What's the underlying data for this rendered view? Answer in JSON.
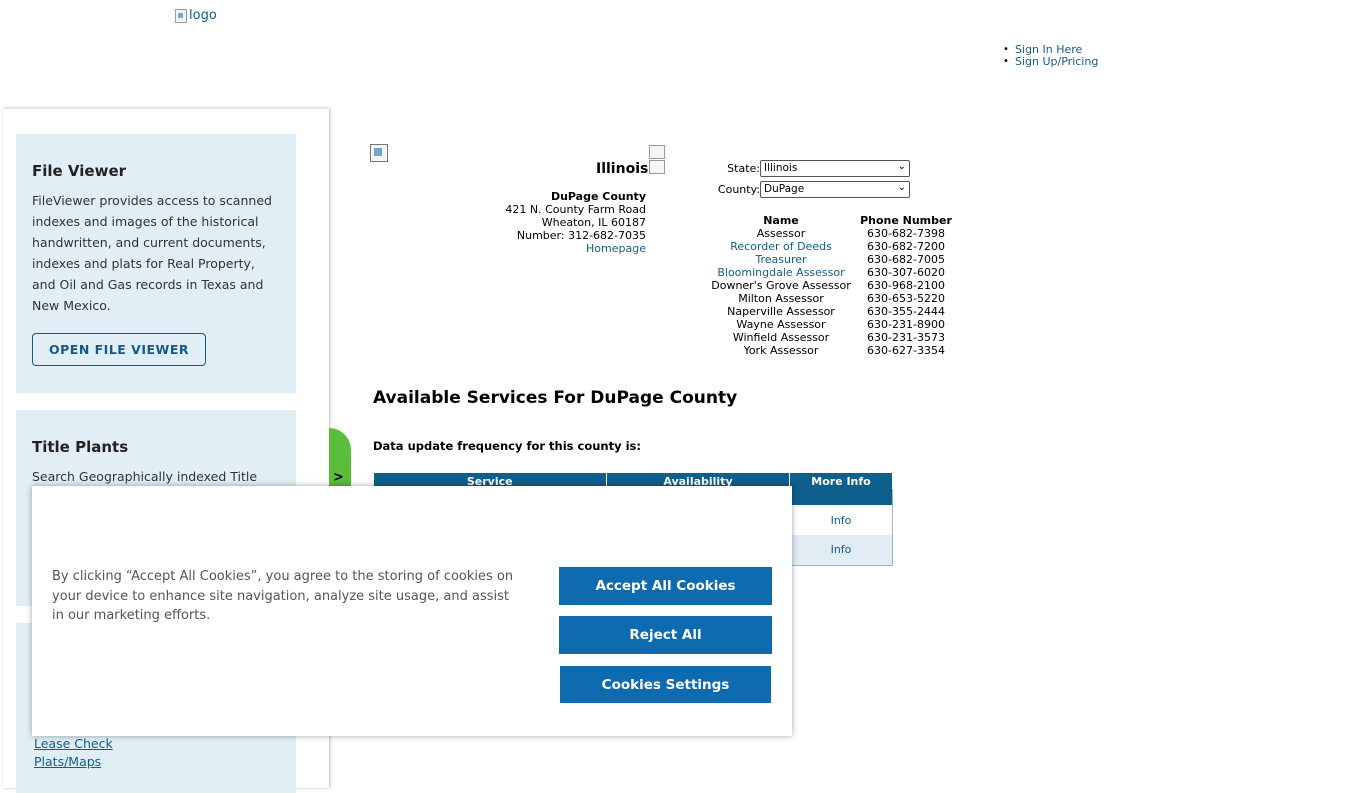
{
  "header": {
    "logo_alt": "logo",
    "user_links": [
      "Sign In Here",
      "Sign Up/Pricing"
    ]
  },
  "sidebar": {
    "file_viewer": {
      "title": "File Viewer",
      "description": "FileViewer provides access to scanned indexes and images of the historical handwritten, and current documents, indexes and plats for Real Property, and Oil and Gas records in Texas and New Mexico.",
      "button": "OPEN FILE VIEWER"
    },
    "title_plants": {
      "title": "Title Plants",
      "description": "Search Geographically indexed Title"
    },
    "bottom_links": [
      "Lease Check",
      "Plats/Maps"
    ],
    "tab_arrow": ">"
  },
  "county": {
    "state_name": "Illinois",
    "county_name": "DuPage County",
    "address_line1": "421 N. County Farm Road",
    "address_line2": "Wheaton, IL 60187",
    "phone_line": "Number: 312-682-7035",
    "homepage_link": "Homepage"
  },
  "selectors": {
    "state_label": "State:",
    "state_value": "Illinois",
    "county_label": "County:",
    "county_value": "DuPage"
  },
  "contacts": {
    "headers": [
      "Name",
      "Phone Number"
    ],
    "rows": [
      {
        "name": "Assessor",
        "phone": "630-682-7398",
        "link": false
      },
      {
        "name": "Recorder of Deeds",
        "phone": "630-682-7200",
        "link": true
      },
      {
        "name": "Treasurer",
        "phone": "630-682-7005",
        "link": true
      },
      {
        "name": "Bloomingdale Assessor",
        "phone": "630-307-6020",
        "link": true
      },
      {
        "name": "Downer's Grove Assessor",
        "phone": "630-968-2100",
        "link": false
      },
      {
        "name": "Milton Assessor",
        "phone": "630-653-5220",
        "link": false
      },
      {
        "name": "Naperville Assessor",
        "phone": "630-355-2444",
        "link": false
      },
      {
        "name": "Wayne Assessor",
        "phone": "630-231-8900",
        "link": false
      },
      {
        "name": "Winfield Assessor",
        "phone": "630-231-3573",
        "link": false
      },
      {
        "name": "York Assessor",
        "phone": "630-627-3354",
        "link": false
      }
    ]
  },
  "services": {
    "title": "Available Services For DuPage County",
    "frequency_text": "Data update frequency for this county is:",
    "headers": [
      "Service",
      "Availability",
      "More Info"
    ],
    "rows": [
      {
        "info": "Info"
      },
      {
        "info": "Info"
      }
    ]
  },
  "cookie_banner": {
    "text": "By clicking “Accept All Cookies”, you agree to the storing of cookies on your device to enhance site navigation, analyze site usage, and assist in our marketing efforts.",
    "accept_label": "Accept All Cookies",
    "reject_label": "Reject All",
    "settings_label": "Cookies Settings"
  },
  "colors": {
    "link": "#0f5e8c",
    "table_header": "#0f5e8c",
    "card_bg": "#e1eef6",
    "cookie_button": "#0e6bb0",
    "green_tab": "#5bbd3c"
  }
}
